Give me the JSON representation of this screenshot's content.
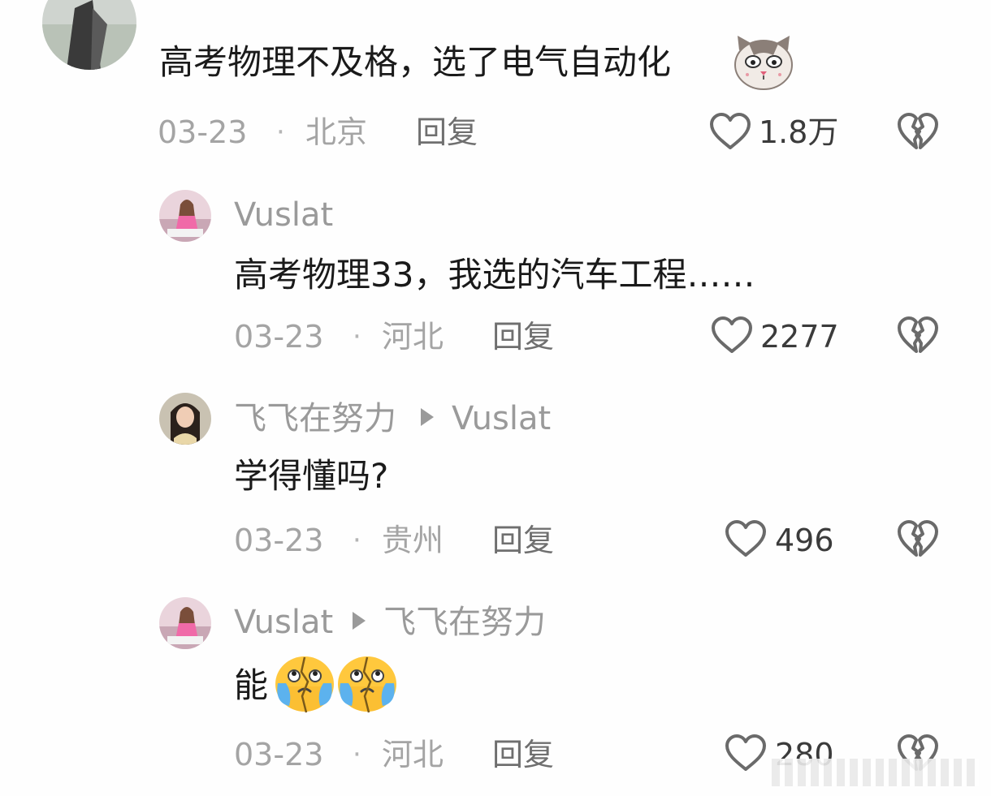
{
  "comments": [
    {
      "text": "高考物理不及格，选了电气自动化",
      "emoji": "cat-face-emoji",
      "date": "03-23",
      "location": "北京",
      "reply_label": "回复",
      "likes": "1.8万"
    },
    {
      "username": "Vuslat",
      "text": "高考物理33，我选的汽车工程……",
      "date": "03-23",
      "location": "河北",
      "reply_label": "回复",
      "likes": "2277"
    },
    {
      "username": "飞飞在努力",
      "reply_to": "Vuslat",
      "text": "学得懂吗?",
      "date": "03-23",
      "location": "贵州",
      "reply_label": "回复",
      "likes": "496"
    },
    {
      "username": "Vuslat",
      "reply_to": "飞飞在努力",
      "text": "能",
      "emoji": "crying-face-emoji",
      "date": "03-23",
      "location": "河北",
      "reply_label": "回复",
      "likes": "280"
    }
  ],
  "separator": "·",
  "colors": {
    "text": "#1a1a1a",
    "meta": "#a4a4a4",
    "reply": "#6f6f6f",
    "icon": "#6a6a6a"
  }
}
